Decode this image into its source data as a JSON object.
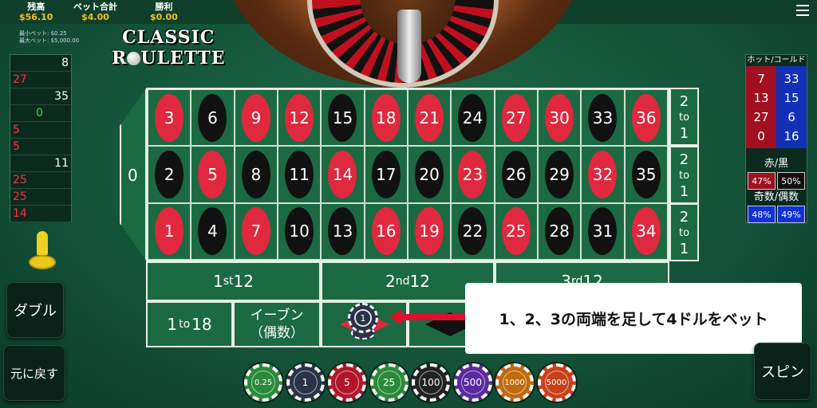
{
  "header": {
    "balance_label": "残高",
    "balance_value": "$56.10",
    "bet_label": "ベット合計",
    "bet_value": "$4.00",
    "win_label": "勝利",
    "win_value": "$0.00"
  },
  "limits": {
    "min": "最小ベット: $0.25",
    "max": "最大ベット: $5,000.00"
  },
  "logo": {
    "line1": "CLASSIC",
    "line2_a": "R",
    "line2_b": "ULETTE"
  },
  "history": [
    {
      "n": "8",
      "c": "#ffffff",
      "side": "right"
    },
    {
      "n": "27",
      "c": "#ff3040",
      "side": "left"
    },
    {
      "n": "35",
      "c": "#ffffff",
      "side": "right"
    },
    {
      "n": "0",
      "c": "#30e040",
      "side": "center"
    },
    {
      "n": "5",
      "c": "#ff3040",
      "side": "left"
    },
    {
      "n": "5",
      "c": "#ff3040",
      "side": "left"
    },
    {
      "n": "11",
      "c": "#ffffff",
      "side": "right"
    },
    {
      "n": "25",
      "c": "#ff3040",
      "side": "left"
    },
    {
      "n": "25",
      "c": "#ff3040",
      "side": "left"
    },
    {
      "n": "14",
      "c": "#ff3040",
      "side": "left"
    }
  ],
  "table": {
    "zero": "0",
    "rows": [
      [
        [
          "3",
          "red"
        ],
        [
          "6",
          "black"
        ],
        [
          "9",
          "red"
        ],
        [
          "12",
          "red"
        ],
        [
          "15",
          "black"
        ],
        [
          "18",
          "red"
        ],
        [
          "21",
          "red"
        ],
        [
          "24",
          "black"
        ],
        [
          "27",
          "red"
        ],
        [
          "30",
          "red"
        ],
        [
          "33",
          "black"
        ],
        [
          "36",
          "red"
        ]
      ],
      [
        [
          "2",
          "black"
        ],
        [
          "5",
          "red"
        ],
        [
          "8",
          "black"
        ],
        [
          "11",
          "black"
        ],
        [
          "14",
          "red"
        ],
        [
          "17",
          "black"
        ],
        [
          "20",
          "black"
        ],
        [
          "23",
          "red"
        ],
        [
          "26",
          "black"
        ],
        [
          "29",
          "black"
        ],
        [
          "32",
          "red"
        ],
        [
          "35",
          "black"
        ]
      ],
      [
        [
          "1",
          "red"
        ],
        [
          "4",
          "black"
        ],
        [
          "7",
          "red"
        ],
        [
          "10",
          "black"
        ],
        [
          "13",
          "black"
        ],
        [
          "16",
          "red"
        ],
        [
          "19",
          "red"
        ],
        [
          "22",
          "black"
        ],
        [
          "25",
          "red"
        ],
        [
          "28",
          "black"
        ],
        [
          "31",
          "black"
        ],
        [
          "34",
          "red"
        ]
      ]
    ],
    "column_bet": "2 to 1",
    "col_a": "2",
    "col_b": "to",
    "col_c": "1",
    "dozens": [
      {
        "a": "1",
        "b": "st",
        "c": "12"
      },
      {
        "a": "2",
        "b": "nd",
        "c": "12"
      },
      {
        "a": "3",
        "b": "rd",
        "c": "12"
      }
    ],
    "low": {
      "a": "1 ",
      "b": "to",
      "c": "18"
    },
    "even": {
      "a": "イーブン",
      "b": "（偶数）"
    },
    "placed_chip": "1"
  },
  "tooltip": "1、2、3の両端を足して4ドルをベット",
  "stats": {
    "hotcold_title": "ホット/コールド",
    "hot": [
      "7",
      "13",
      "27",
      "0"
    ],
    "cold": [
      "33",
      "15",
      "6",
      "16"
    ],
    "redblack_title": "赤/黒",
    "red_pct": "47%",
    "black_pct": "50%",
    "oddeven_title": "奇数/偶数",
    "odd_pct": "48%",
    "even_pct": "49%"
  },
  "buttons": {
    "double": "ダブル",
    "undo": "元に戻す",
    "spin": "スピン"
  },
  "chips": [
    {
      "v": "0.25",
      "color": "#2a8a3a"
    },
    {
      "v": "1",
      "color": "#2a3448"
    },
    {
      "v": "5",
      "color": "#b0162a"
    },
    {
      "v": "25",
      "color": "#2a8a3a"
    },
    {
      "v": "100",
      "color": "#222222"
    },
    {
      "v": "500",
      "color": "#5a2aa0"
    },
    {
      "v": "1000",
      "color": "#c06a10"
    },
    {
      "v": "5000",
      "color": "#c8401a"
    }
  ],
  "colors": {
    "red": "#e0283e",
    "black": "#111111",
    "gold": "#f0c020"
  }
}
